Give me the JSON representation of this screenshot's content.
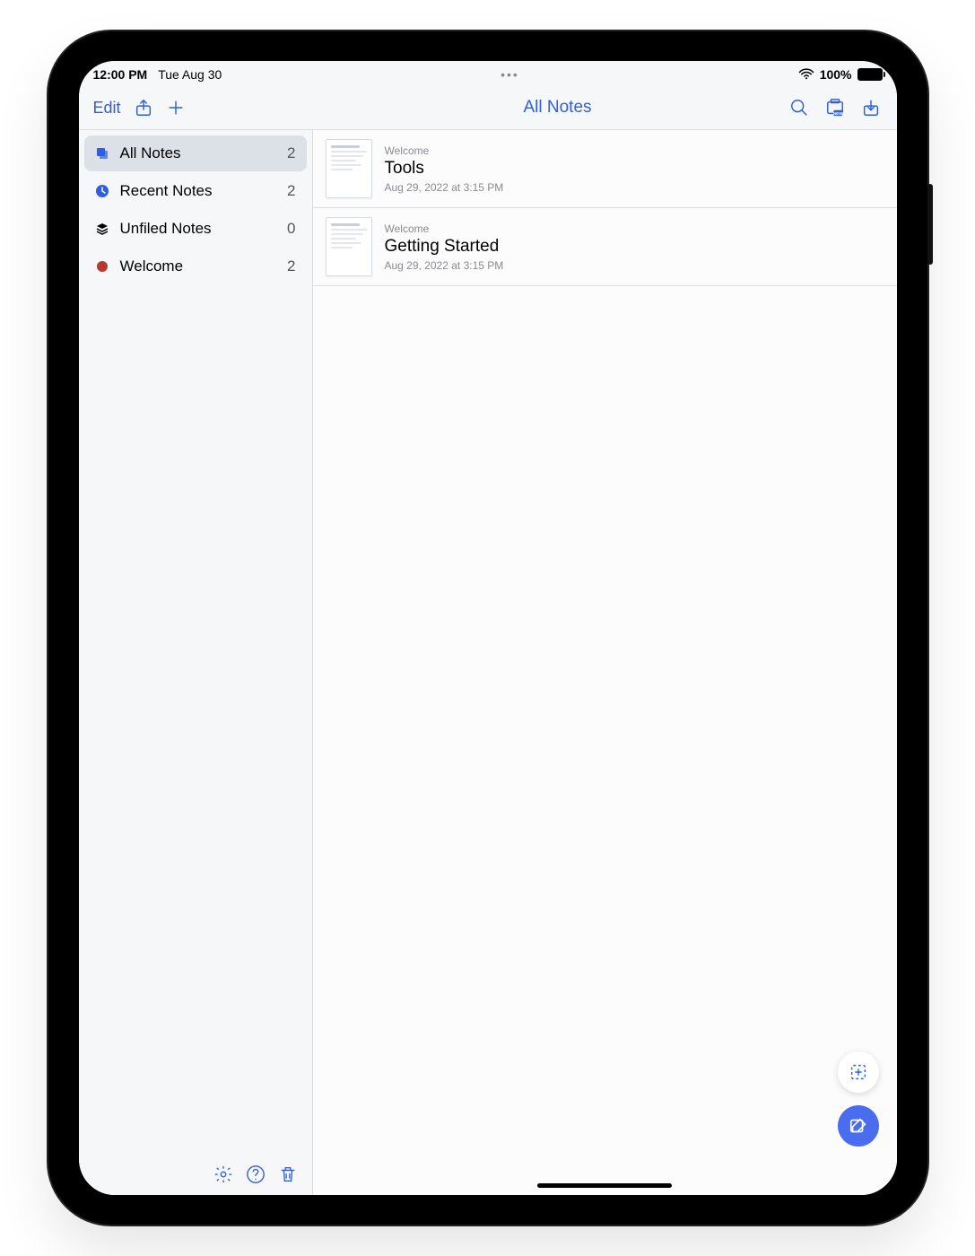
{
  "statusbar": {
    "time": "12:00 PM",
    "date": "Tue Aug 30",
    "battery_pct": "100%"
  },
  "toolbar": {
    "edit_label": "Edit",
    "title": "All Notes"
  },
  "sidebar": {
    "items": [
      {
        "label": "All Notes",
        "count": "2",
        "icon": "stack-icon",
        "color": "#2f5fe0",
        "selected": true
      },
      {
        "label": "Recent Notes",
        "count": "2",
        "icon": "clock-icon",
        "color": "#2f5fe0",
        "selected": false
      },
      {
        "label": "Unfiled Notes",
        "count": "0",
        "icon": "layers-icon",
        "color": "#000",
        "selected": false
      },
      {
        "label": "Welcome",
        "count": "2",
        "icon": "dot-icon",
        "color": "#b53a2d",
        "selected": false
      }
    ]
  },
  "notes": [
    {
      "category": "Welcome",
      "title": "Tools",
      "date": "Aug 29, 2022 at 3:15 PM"
    },
    {
      "category": "Welcome",
      "title": "Getting Started",
      "date": "Aug 29, 2022 at 3:15 PM"
    }
  ]
}
